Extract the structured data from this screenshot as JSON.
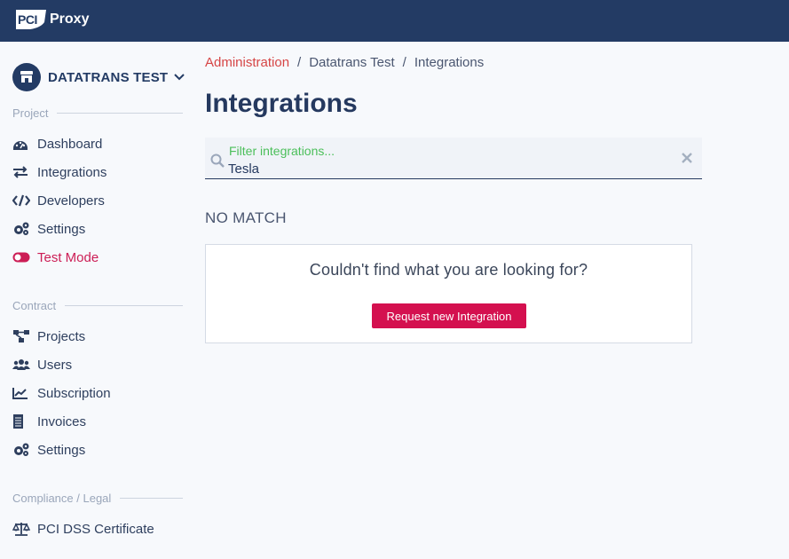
{
  "brand": {
    "badge": "PCI",
    "name": "Proxy"
  },
  "account": {
    "name": "DATATRANS TEST"
  },
  "sections": {
    "project": "Project",
    "contract": "Contract",
    "compliance": "Compliance / Legal"
  },
  "nav": {
    "project": [
      {
        "label": "Dashboard",
        "icon": "dashboard-icon"
      },
      {
        "label": "Integrations",
        "icon": "arrows-exchange-icon"
      },
      {
        "label": "Developers",
        "icon": "code-icon"
      },
      {
        "label": "Settings",
        "icon": "gears-icon"
      },
      {
        "label": "Test Mode",
        "icon": "toggle-icon"
      }
    ],
    "contract": [
      {
        "label": "Projects",
        "icon": "sitemap-icon"
      },
      {
        "label": "Users",
        "icon": "users-icon"
      },
      {
        "label": "Subscription",
        "icon": "line-chart-icon"
      },
      {
        "label": "Invoices",
        "icon": "invoice-icon"
      },
      {
        "label": "Settings",
        "icon": "gears-icon"
      }
    ],
    "compliance": [
      {
        "label": "PCI DSS Certificate",
        "icon": "balance-scale-icon"
      }
    ]
  },
  "breadcrumb": [
    "Administration",
    "Datatrans Test",
    "Integrations"
  ],
  "page": {
    "title": "Integrations"
  },
  "filter": {
    "placeholder": "Filter integrations...",
    "value": "Tesla"
  },
  "results": {
    "status": "NO MATCH",
    "message": "Couldn't find what you are looking for?",
    "button": "Request new Integration"
  },
  "colors": {
    "topbar": "#233b64",
    "accent": "#d4104f",
    "link": "#d64545",
    "placeholder": "#4bbf5a"
  }
}
